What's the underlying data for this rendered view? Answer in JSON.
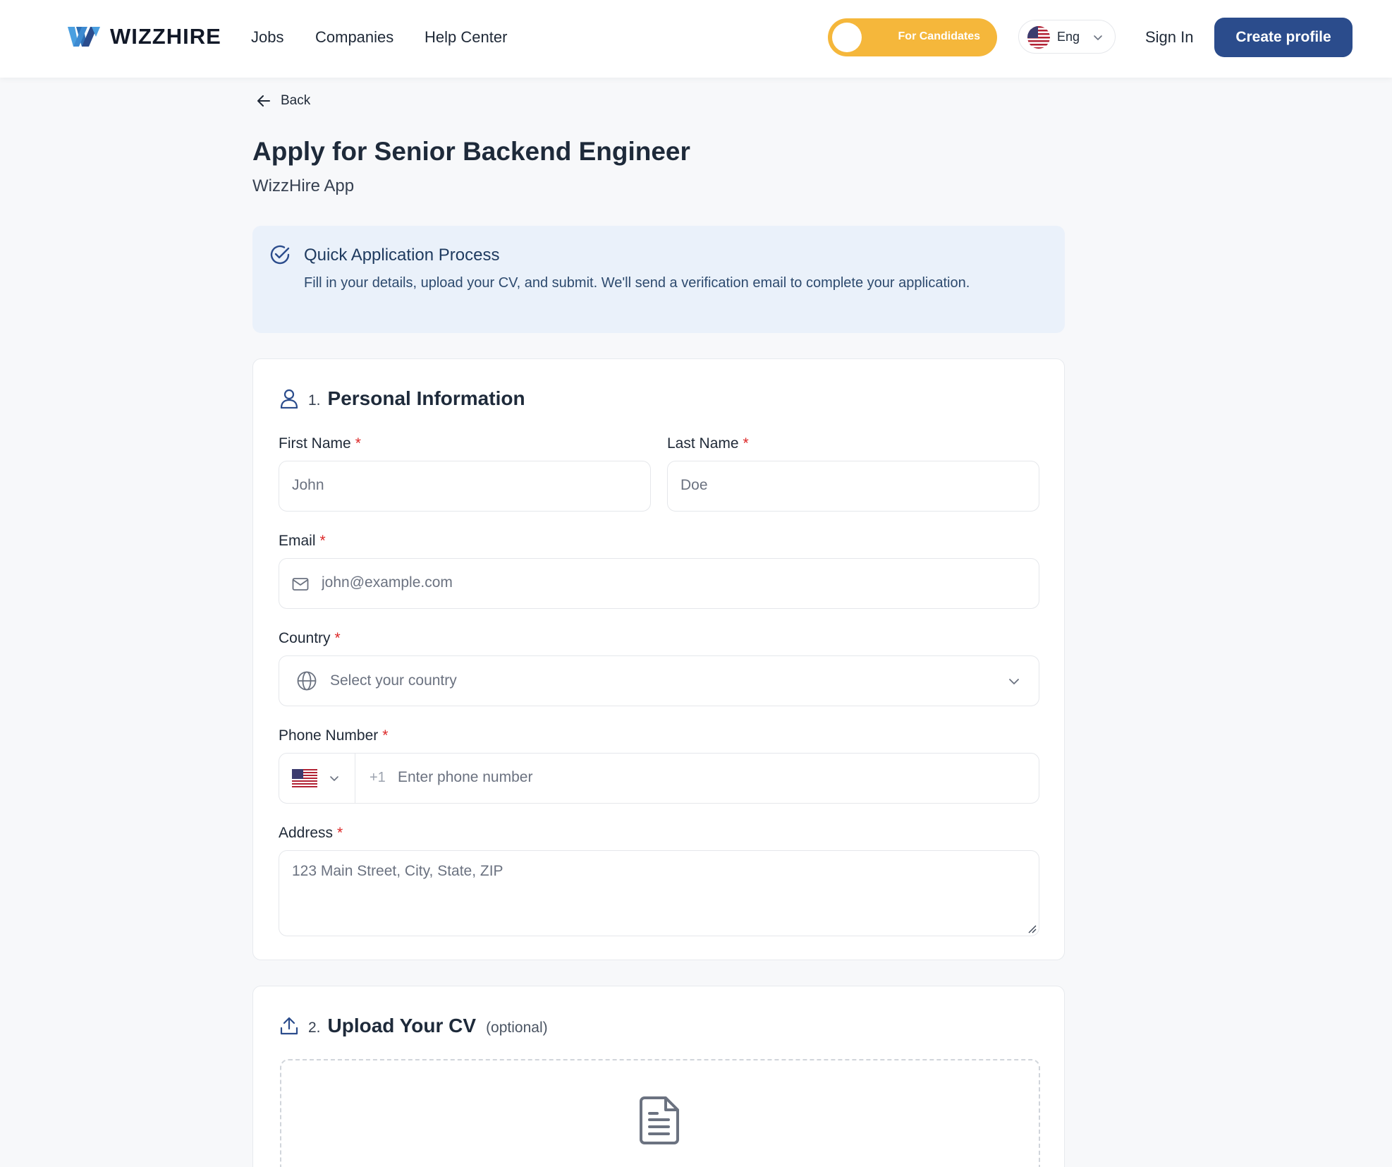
{
  "header": {
    "brand": "WIZZHIRE",
    "nav": [
      "Jobs",
      "Companies",
      "Help Center"
    ],
    "toggle_label": "For Candidates",
    "language": "Eng",
    "sign_in": "Sign In",
    "create_profile": "Create profile"
  },
  "page": {
    "back": "Back",
    "title": "Apply for Senior Backend Engineer",
    "company": "WizzHire App"
  },
  "info": {
    "title": "Quick Application Process",
    "text": "Fill in your details, upload your CV, and submit. We'll send a verification email to complete your application."
  },
  "personal": {
    "number": "1.",
    "title": "Personal Information",
    "first_name": {
      "label": "First Name",
      "placeholder": "John"
    },
    "last_name": {
      "label": "Last Name",
      "placeholder": "Doe"
    },
    "email": {
      "label": "Email",
      "placeholder": "john@example.com"
    },
    "country": {
      "label": "Country",
      "placeholder": "Select your country"
    },
    "phone": {
      "label": "Phone Number",
      "prefix": "+1",
      "placeholder": "Enter phone number"
    },
    "address": {
      "label": "Address",
      "placeholder": "123 Main Street, City, State, ZIP"
    },
    "required_mark": "*"
  },
  "upload": {
    "number": "2.",
    "title": "Upload Your CV",
    "optional": "(optional)"
  },
  "colors": {
    "primary": "#2b4c8c",
    "toggle": "#f5b73b",
    "required": "#dc2626",
    "info_bg": "#eaf1fa"
  }
}
